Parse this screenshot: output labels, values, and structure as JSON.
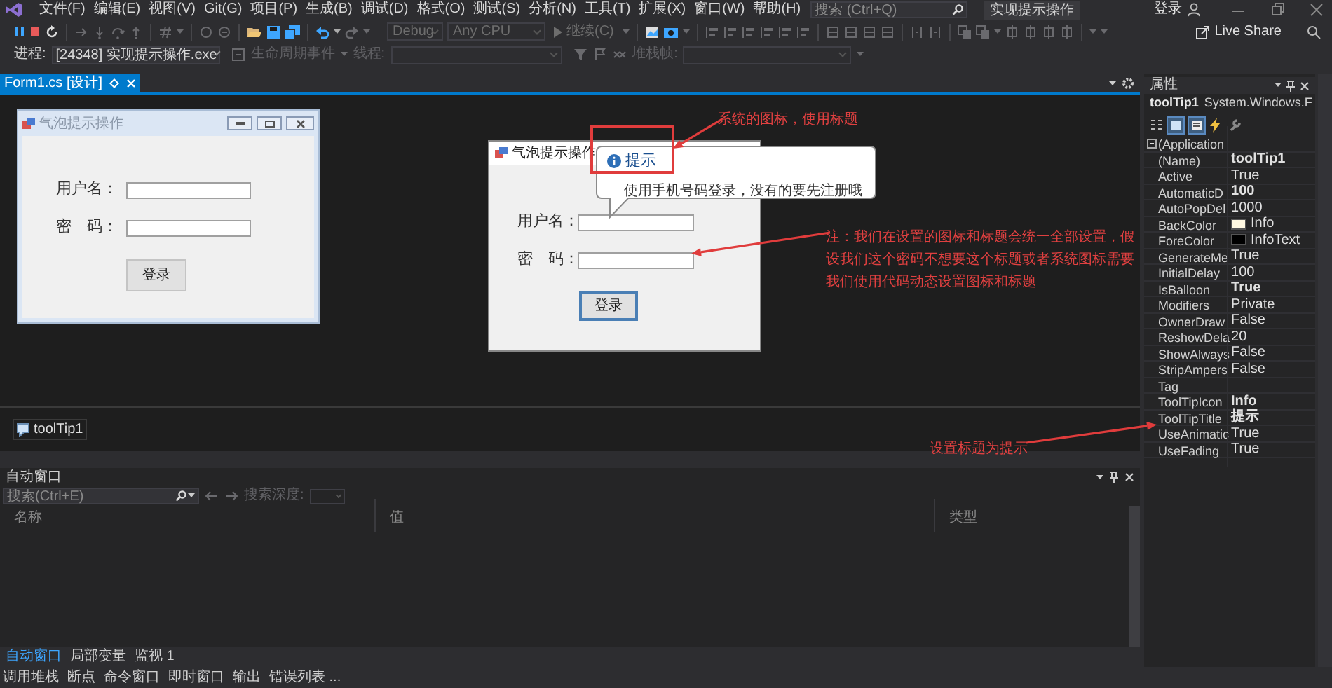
{
  "menu_bar": {
    "items": [
      "文件(F)",
      "编辑(E)",
      "视图(V)",
      "Git(G)",
      "项目(P)",
      "生成(B)",
      "调试(D)",
      "格式(O)",
      "测试(S)",
      "分析(N)",
      "工具(T)",
      "扩展(X)",
      "窗口(W)",
      "帮助(H)"
    ],
    "search": {
      "placeholder": "搜索 (Ctrl+Q)"
    },
    "solution_title": "实现提示操作",
    "sign_in": "登录"
  },
  "toolbar": {
    "configuration": {
      "value": "Debug",
      "disabled": true
    },
    "platform": {
      "value": "Any CPU",
      "disabled": true
    },
    "continue": {
      "label": "继续(C)",
      "disabled": true
    },
    "live_share": "Live Share"
  },
  "debug_location": {
    "process_label": "进程:",
    "process": "[24348] 实现提示操作.exe",
    "lifecycle_events": {
      "label": "生命周期事件",
      "disabled": true
    },
    "thread_label": "线程:",
    "stack_frame_label": "堆栈帧:"
  },
  "document_tabs": [
    {
      "label": "Form1.cs [设计]",
      "selected": true
    }
  ],
  "designer": {
    "forms": [
      {
        "kind": "designer",
        "title": "气泡提示操作",
        "username_label": "用户名：",
        "password_label": "密　码：",
        "login_button": "登录",
        "button_focused": false
      },
      {
        "kind": "window",
        "title": "气泡提示操作",
        "username_label": "用户名：",
        "password_label": "密　码：",
        "login_button": "登录",
        "button_focused": true
      }
    ],
    "balloon_tooltip": {
      "title": "提示",
      "text": "使用手机号码登录，没有的要先注册哦"
    },
    "component_tray": [
      {
        "label": "toolTip1"
      }
    ]
  },
  "annotations": [
    {
      "text": "系统的图标，使用标题"
    },
    {
      "text": "注：我们在设置的图标和标题会统一全部设置，假设我们这个密码不想要这个标题或者系统图标需要我们使用代码动态设置图标和标题"
    },
    {
      "text": "设置标题为提示"
    }
  ],
  "autos_window": {
    "title": "自动窗口",
    "search": {
      "placeholder": "搜索(Ctrl+E)"
    },
    "search_depth_label": "搜索深度:",
    "columns": [
      "名称",
      "值",
      "类型"
    ]
  },
  "bottom_tabs": [
    {
      "label": "自动窗口",
      "selected": true
    },
    {
      "label": "局部变量",
      "selected": false
    },
    {
      "label": "监视 1",
      "selected": false
    }
  ],
  "tool_windows": [
    "调用堆栈",
    "断点",
    "命令窗口",
    "即时窗口",
    "输出",
    "错误列表 ..."
  ],
  "properties": {
    "title": "属性",
    "object_name": "toolTip1",
    "object_type": "System.Windows.F",
    "rows": [
      {
        "name": "(Application",
        "expandable": true
      },
      {
        "name": "(Name)",
        "value": "toolTip1",
        "modified": true
      },
      {
        "name": "Active",
        "value": "True",
        "modified": false
      },
      {
        "name": "AutomaticD",
        "value": "100",
        "modified": true
      },
      {
        "name": "AutoPopDel",
        "value": "1000",
        "modified": false
      },
      {
        "name": "BackColor",
        "value": "Info",
        "modified": false,
        "color": "#fff8e1"
      },
      {
        "name": "ForeColor",
        "value": "InfoText",
        "modified": false,
        "color": "#000000"
      },
      {
        "name": "GenerateMe",
        "value": "True",
        "modified": false
      },
      {
        "name": "InitialDelay",
        "value": "100",
        "modified": false
      },
      {
        "name": "IsBalloon",
        "value": "True",
        "modified": true
      },
      {
        "name": "Modifiers",
        "value": "Private",
        "modified": false
      },
      {
        "name": "OwnerDraw",
        "value": "False",
        "modified": false
      },
      {
        "name": "ReshowDela",
        "value": "20",
        "modified": false
      },
      {
        "name": "ShowAlways",
        "value": "False",
        "modified": false
      },
      {
        "name": "StripAmpers",
        "value": "False",
        "modified": false
      },
      {
        "name": "Tag"
      },
      {
        "name": "ToolTipIcon",
        "value": "Info",
        "modified": true
      },
      {
        "name": "ToolTipTitle",
        "value": "提示",
        "modified": true
      },
      {
        "name": "UseAnimatic",
        "value": "True",
        "modified": false
      },
      {
        "name": "UseFading",
        "value": "True",
        "modified": false
      }
    ]
  }
}
